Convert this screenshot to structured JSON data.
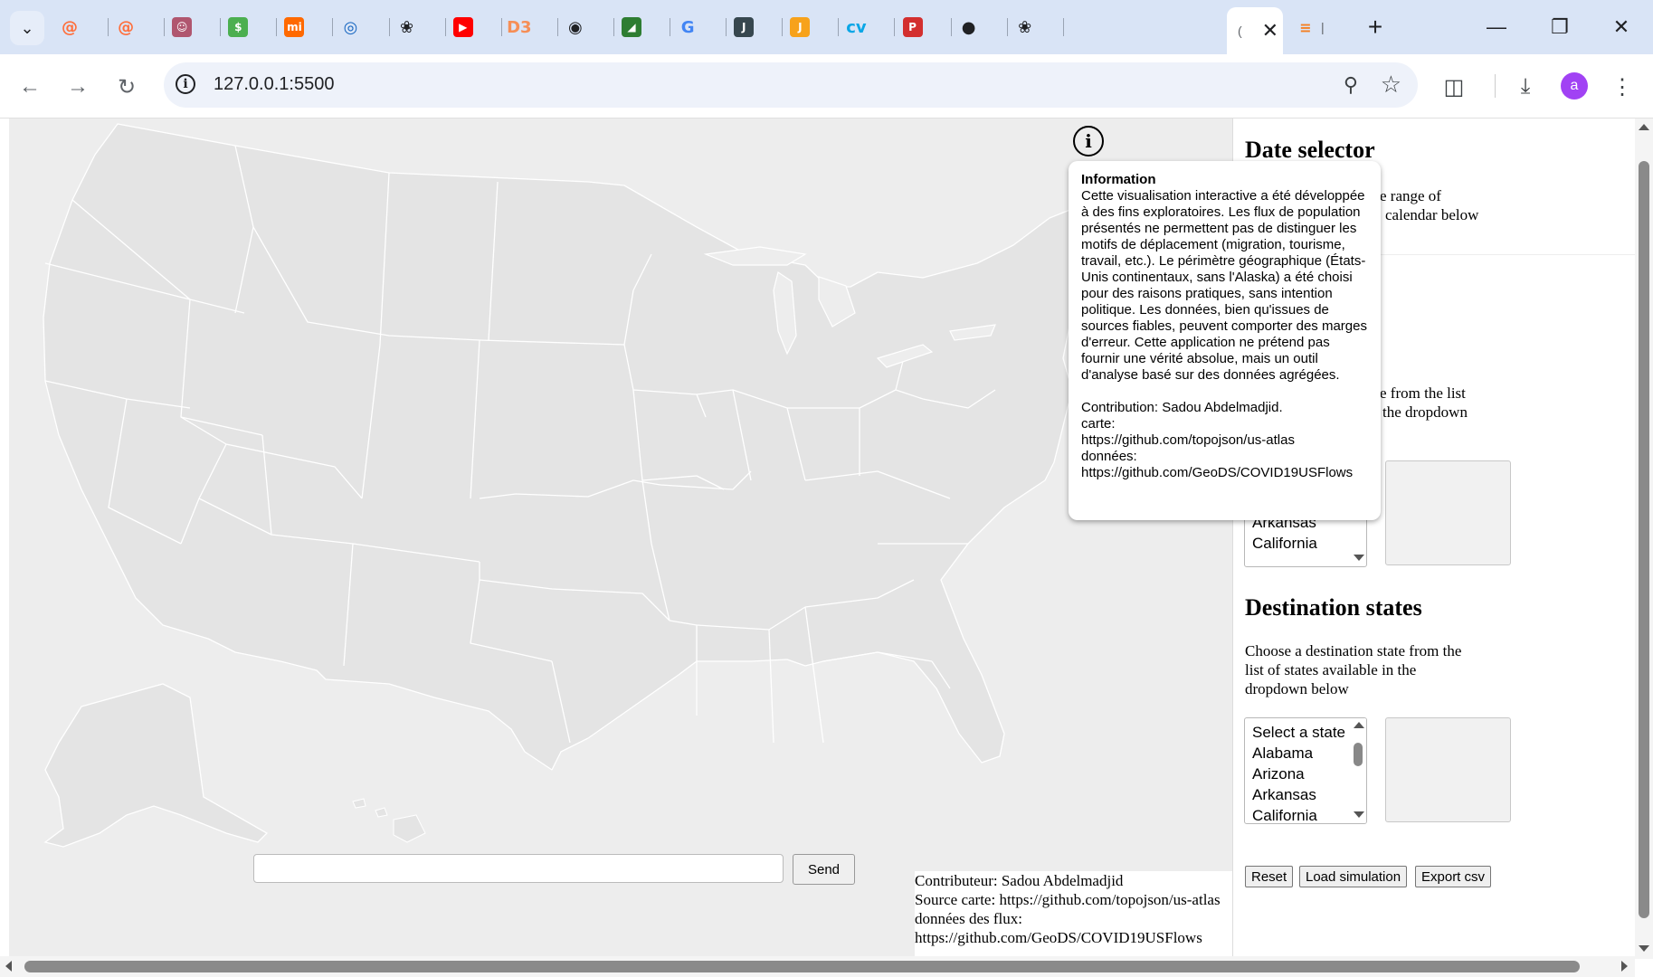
{
  "browser": {
    "tabs_favicons": [
      {
        "icon": "swirl-icon",
        "color": "#ff6f3c"
      },
      {
        "icon": "swirl-icon",
        "color": "#ff6f3c"
      },
      {
        "icon": "avatar-icon",
        "color": "#b0566f"
      },
      {
        "icon": "money-icon",
        "color": "#4caf50"
      },
      {
        "icon": "mi-logo-icon",
        "color": "#ff6900"
      },
      {
        "icon": "target-icon",
        "color": "#1565c0"
      },
      {
        "icon": "openai-icon",
        "color": "#202124"
      },
      {
        "icon": "youtube-icon",
        "color": "#ff0000"
      },
      {
        "icon": "d3-logo-icon",
        "color": "#f68e56"
      },
      {
        "icon": "spiral-icon",
        "color": "#202124"
      },
      {
        "icon": "chart-icon",
        "color": "#2e7d32"
      },
      {
        "icon": "google-icon",
        "color": "#4285f4"
      },
      {
        "icon": "job-icon",
        "color": "#37474f"
      },
      {
        "icon": "job-icon",
        "color": "#f7a21b"
      },
      {
        "icon": "cv-icon",
        "color": "#0aa6e6"
      },
      {
        "icon": "png-pdf-icon",
        "color": "#d32f2f"
      },
      {
        "icon": "github-icon",
        "color": "#202124"
      },
      {
        "icon": "openai-icon",
        "color": "#202124"
      }
    ],
    "last_tab_favicon": {
      "icon": "stackoverflow-icon",
      "color": "#f48024"
    },
    "url": "127.0.0.1:5500",
    "avatar_letter": "a",
    "avatar_color": "#a142f4"
  },
  "map": {
    "info_icon": "i",
    "tooltip": {
      "title": "Information",
      "body": "Cette visualisation interactive a été développée à des fins exploratoires. Les flux de population présentés ne permettent pas de distinguer les motifs de déplacement (migration, tourisme, travail, etc.). Le périmètre géographique (États-Unis continentaux, sans l'Alaska) a été choisi pour des raisons pratiques, sans intention politique. Les données, bien qu'issues de sources fiables, peuvent comporter des marges d'erreur. Cette application ne prétend pas fournir une vérité absolue, mais un outil d'analyse basé sur des données agrégées.",
      "contribution": "Contribution: Sadou Abdelmadjid.",
      "carte_label": "carte:",
      "carte_url": "https://github.com/topojson/us-atlas",
      "donnees_label": "données:",
      "donnees_url": "https://github.com/GeoDS/COVID19USFlows"
    },
    "send_input_value": "",
    "send_label": "Send",
    "credits": {
      "line1": "Contributeur: Sadou Abdelmadjid",
      "line2": "Source carte: https://github.com/topojson/us-atlas",
      "line3": "données des flux:",
      "line4": "https://github.com/GeoDS/COVID19USFlows"
    },
    "land_color": "#e4e4e4",
    "border_color": "#ffffff",
    "background_color": "#ededed"
  },
  "sidebar": {
    "date_selector": {
      "title": "Date selector",
      "desc_line1": "e range of",
      "desc_line2": "calendar below"
    },
    "origin": {
      "desc_line1": "e from the list",
      "desc_line2": "the dropdown",
      "options_visible": [
        "Arkansas",
        "California"
      ]
    },
    "destination": {
      "title": "Destination states",
      "desc_line1": "Choose a destination state from the",
      "desc_line2": "list of states available in the",
      "desc_line3": "dropdown below",
      "options": [
        "Select a state",
        "Alabama",
        "Arizona",
        "Arkansas",
        "California"
      ]
    },
    "buttons": {
      "reset": "Reset",
      "load": "Load simulation",
      "export": "Export csv"
    }
  }
}
